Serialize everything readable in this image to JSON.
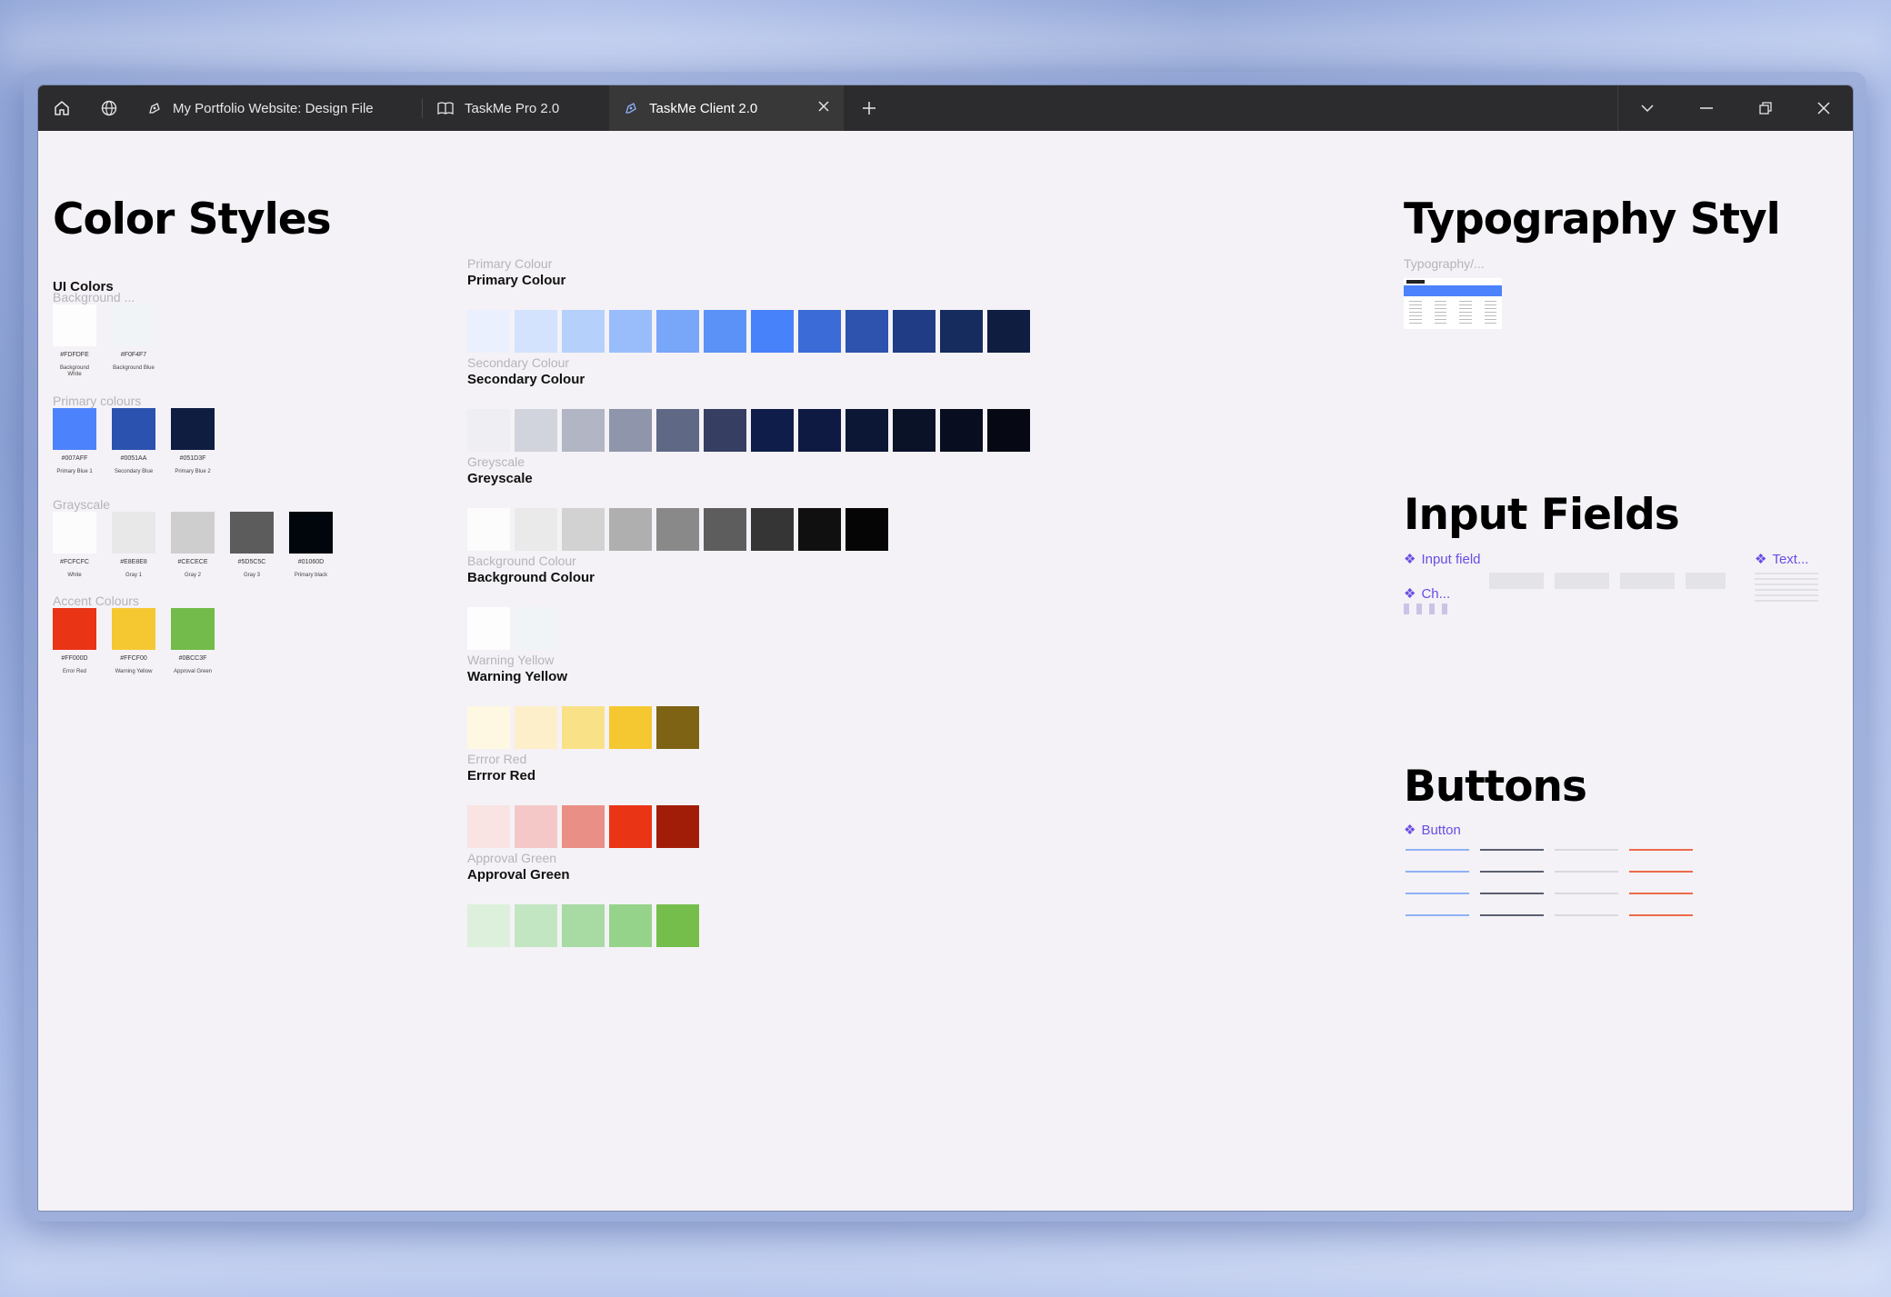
{
  "tabs": [
    {
      "label": "My Portfolio Website: Design File",
      "icon": "figma-file-icon"
    },
    {
      "label": "TaskMe Pro 2.0",
      "icon": "book-icon"
    },
    {
      "label": "TaskMe Client 2.0",
      "icon": "figma-file-icon",
      "active": true
    }
  ],
  "color_styles": {
    "title": "Color Styles",
    "ui_colors": {
      "title": "UI Colors",
      "groups": [
        {
          "label": "Background ...",
          "swatches": [
            {
              "hex": "#FDFDFE",
              "name": "Background White",
              "color": "#FDFDFE"
            },
            {
              "hex": "#F0F4F7",
              "name": "Background Blue",
              "color": "#F0F4F7"
            }
          ]
        },
        {
          "label": "Primary colours",
          "swatches": [
            {
              "hex": "#007AFF",
              "name": "Primary Blue 1",
              "color": "#4C82FB"
            },
            {
              "hex": "#0051AA",
              "name": "Secondary Blue",
              "color": "#2B52AE"
            },
            {
              "hex": "#051D3F",
              "name": "Primary Blue 2",
              "color": "#0F1D40"
            }
          ]
        },
        {
          "label": "Grayscale",
          "swatches": [
            {
              "hex": "#FCFCFC",
              "name": "White",
              "color": "#FCFCFC"
            },
            {
              "hex": "#E8E8E8",
              "name": "Gray 1",
              "color": "#E8E8E8"
            },
            {
              "hex": "#CECECE",
              "name": "Gray 2",
              "color": "#CECECE"
            },
            {
              "hex": "#5D5C5C",
              "name": "Gray 3",
              "color": "#5D5C5C"
            },
            {
              "hex": "#01060D",
              "name": "Primary black",
              "color": "#01060D"
            }
          ]
        },
        {
          "label": "Accent Colours",
          "swatches": [
            {
              "hex": "#FF000D",
              "name": "Error Red",
              "color": "#EA3416"
            },
            {
              "hex": "#FFCF00",
              "name": "Warning Yellow",
              "color": "#F5C832"
            },
            {
              "hex": "#0BCC3F",
              "name": "Approval Green",
              "color": "#73BB4A"
            }
          ]
        }
      ]
    },
    "palettes": [
      {
        "label": "Primary Colour",
        "title": "Primary Colour",
        "colors": [
          "#EAF0FD",
          "#D3E3FD",
          "#B5D0FB",
          "#98BDFA",
          "#78A6F8",
          "#5B92F7",
          "#4882FA",
          "#3A6BD6",
          "#2D53AE",
          "#1F3C85",
          "#162B5E",
          "#0F1D40"
        ]
      },
      {
        "label": "Secondary Colour",
        "title": "Secondary Colour",
        "colors": [
          "#EFEFF3",
          "#D1D4DD",
          "#B1B5C4",
          "#8F95AA",
          "#5F6885",
          "#363F61",
          "#0F1D4A",
          "#0E1A42",
          "#0C1736",
          "#0A1228",
          "#080E1F",
          "#060913"
        ]
      },
      {
        "label": "Greyscale",
        "title": "Greyscale",
        "colors": [
          "#FCFCFC",
          "#EAEAEA",
          "#D3D2D3",
          "#B0AFB0",
          "#8A898A",
          "#5E5D5E",
          "#363536",
          "#111011",
          "#050505"
        ]
      },
      {
        "label": "Background Colour",
        "title": "Background Colour",
        "colors": [
          "#FDFDFE",
          "#F0F4F7"
        ]
      },
      {
        "label": "Warning Yellow",
        "title": "Warning Yellow",
        "colors": [
          "#FEF7E2",
          "#FDEFC9",
          "#F9E188",
          "#F5C832",
          "#7E6315"
        ]
      },
      {
        "label": "Errror Red",
        "title": "Errror Red",
        "colors": [
          "#F9E3E3",
          "#F4C8C7",
          "#EA8F86",
          "#EA3416",
          "#A21D08"
        ]
      },
      {
        "label": "Approval Green",
        "title": "Approval Green",
        "colors": [
          "#DDF0DC",
          "#C3E6C2",
          "#A8DAA4",
          "#96D38A",
          "#76BE4C"
        ]
      }
    ]
  },
  "typography": {
    "title": "Typography Styl",
    "link": "Typography/..."
  },
  "input_fields": {
    "title": "Input Fields",
    "links": [
      "Input field",
      "Text...",
      "Ch..."
    ]
  },
  "buttons": {
    "title": "Buttons",
    "link": "Button"
  }
}
